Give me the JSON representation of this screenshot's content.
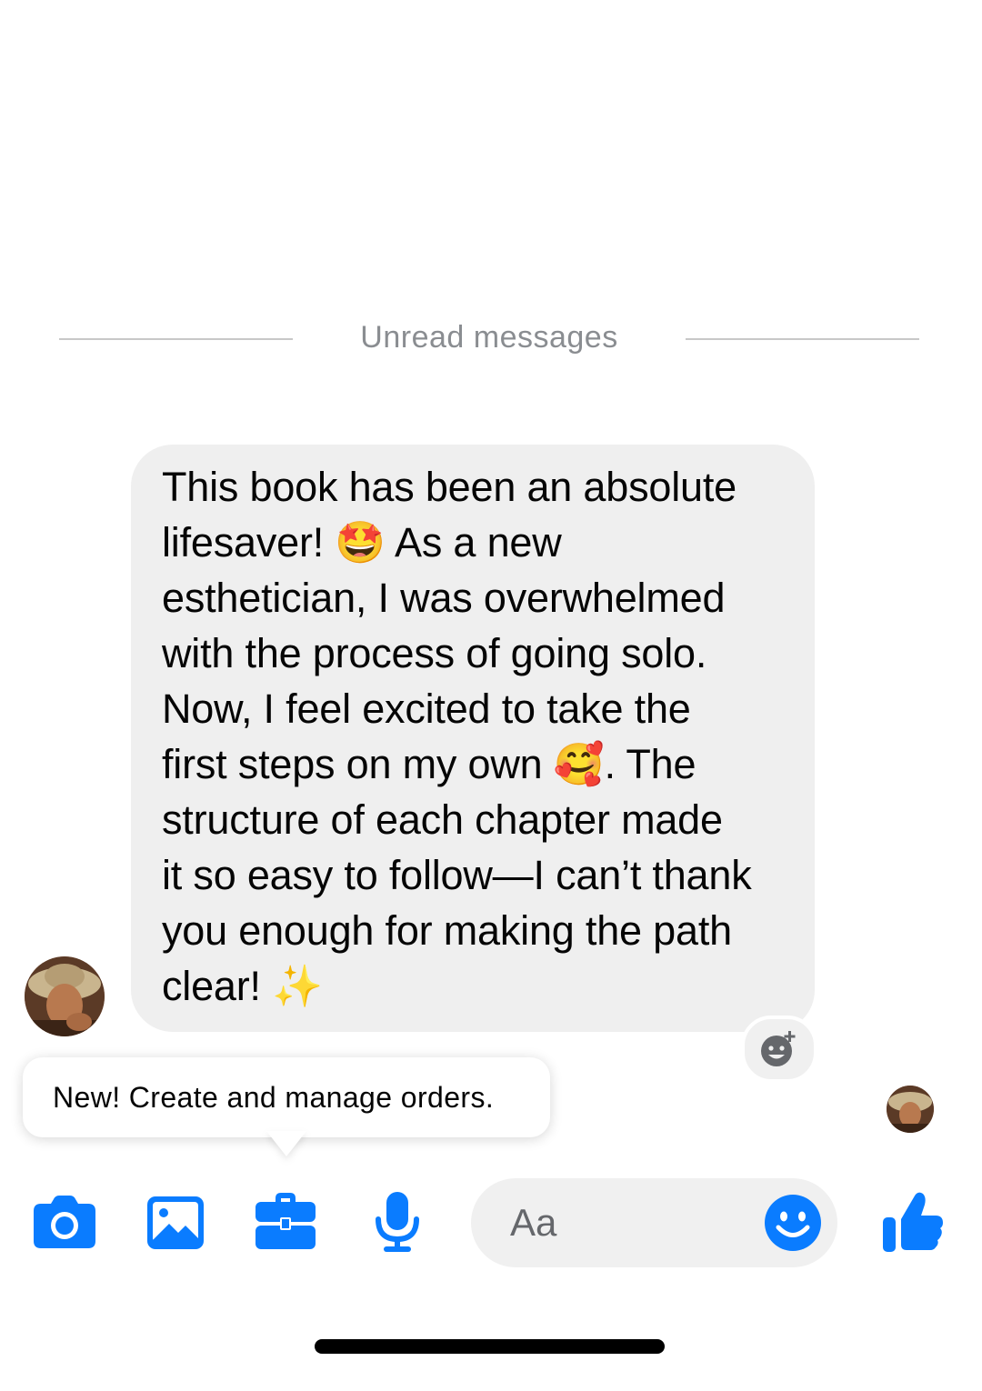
{
  "divider": {
    "label": "Unread messages"
  },
  "message": {
    "text": "This book has been an absolute\nlifesaver! 🤩 As a new\nesthetician, I was overwhelmed\nwith the process of going solo.\nNow, I feel excited to take the\nfirst steps on my own 🥰. The\nstructure of each chapter made\nit so easy to follow—I can’t thank\nyou enough for making the path\nclear! ✨"
  },
  "tooltip": {
    "text": "New! Create and manage orders."
  },
  "composer": {
    "placeholder": "Aa"
  },
  "icons": {
    "react": "add-reaction-icon",
    "camera": "camera-icon",
    "gallery": "gallery-icon",
    "orders": "briefcase-icon",
    "mic": "microphone-icon",
    "emoji": "emoji-icon",
    "like": "thumbs-up-icon"
  },
  "colors": {
    "accent": "#0a7cff",
    "bubble": "#efefef",
    "muted_text": "#8a8d91"
  }
}
